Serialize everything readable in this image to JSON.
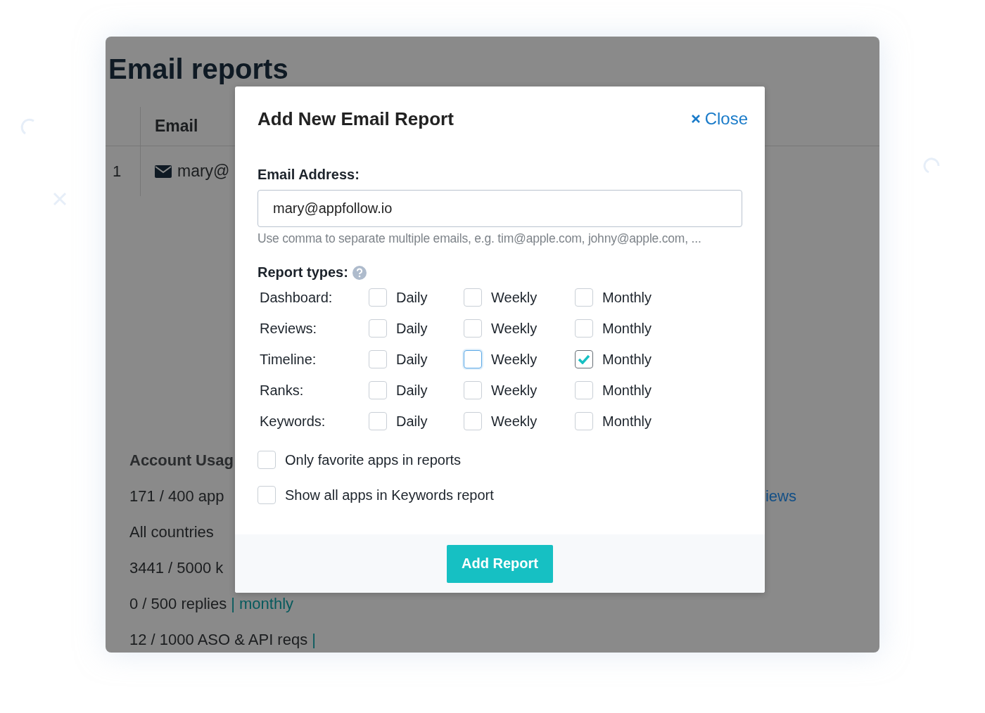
{
  "background": {
    "title": "Email reports",
    "table": {
      "columns": [
        "Email"
      ],
      "rows": [
        {
          "index": "1",
          "email": "mary@"
        }
      ]
    },
    "usage": {
      "title": "Account Usag",
      "lines": [
        {
          "text": "171 / 400 app"
        },
        {
          "text": "All countries"
        },
        {
          "text": "3441 / 5000 k"
        },
        {
          "text": "0 / 500 replies",
          "link": "| monthly"
        },
        {
          "text": "12 / 1000 ASO & API reqs",
          "link": "|"
        }
      ]
    },
    "side_link": "iews"
  },
  "modal": {
    "title": "Add New Email Report",
    "close": "Close",
    "email_label": "Email Address:",
    "email_value": "mary@appfollow.io",
    "hint": "Use comma to separate multiple emails, e.g. tim@apple.com, johny@apple.com, ...",
    "report_types_label": "Report types:",
    "report_types": [
      {
        "label": "Dashboard:",
        "options": [
          {
            "label": "Daily",
            "checked": false,
            "focused": false
          },
          {
            "label": "Weekly",
            "checked": false,
            "focused": false
          },
          {
            "label": "Monthly",
            "checked": false,
            "focused": false
          }
        ]
      },
      {
        "label": "Reviews:",
        "options": [
          {
            "label": "Daily",
            "checked": false,
            "focused": false
          },
          {
            "label": "Weekly",
            "checked": false,
            "focused": false
          },
          {
            "label": "Monthly",
            "checked": false,
            "focused": false
          }
        ]
      },
      {
        "label": "Timeline:",
        "options": [
          {
            "label": "Daily",
            "checked": false,
            "focused": false
          },
          {
            "label": "Weekly",
            "checked": false,
            "focused": true
          },
          {
            "label": "Monthly",
            "checked": true,
            "focused": false
          }
        ]
      },
      {
        "label": "Ranks:",
        "options": [
          {
            "label": "Daily",
            "checked": false,
            "focused": false
          },
          {
            "label": "Weekly",
            "checked": false,
            "focused": false
          },
          {
            "label": "Monthly",
            "checked": false,
            "focused": false
          }
        ]
      },
      {
        "label": "Keywords:",
        "options": [
          {
            "label": "Daily",
            "checked": false,
            "focused": false
          },
          {
            "label": "Weekly",
            "checked": false,
            "focused": false
          },
          {
            "label": "Monthly",
            "checked": false,
            "focused": false
          }
        ]
      }
    ],
    "extra_options": [
      {
        "label": "Only favorite apps in reports",
        "checked": false
      },
      {
        "label": "Show all apps in Keywords report",
        "checked": false
      }
    ],
    "submit": "Add Report"
  }
}
